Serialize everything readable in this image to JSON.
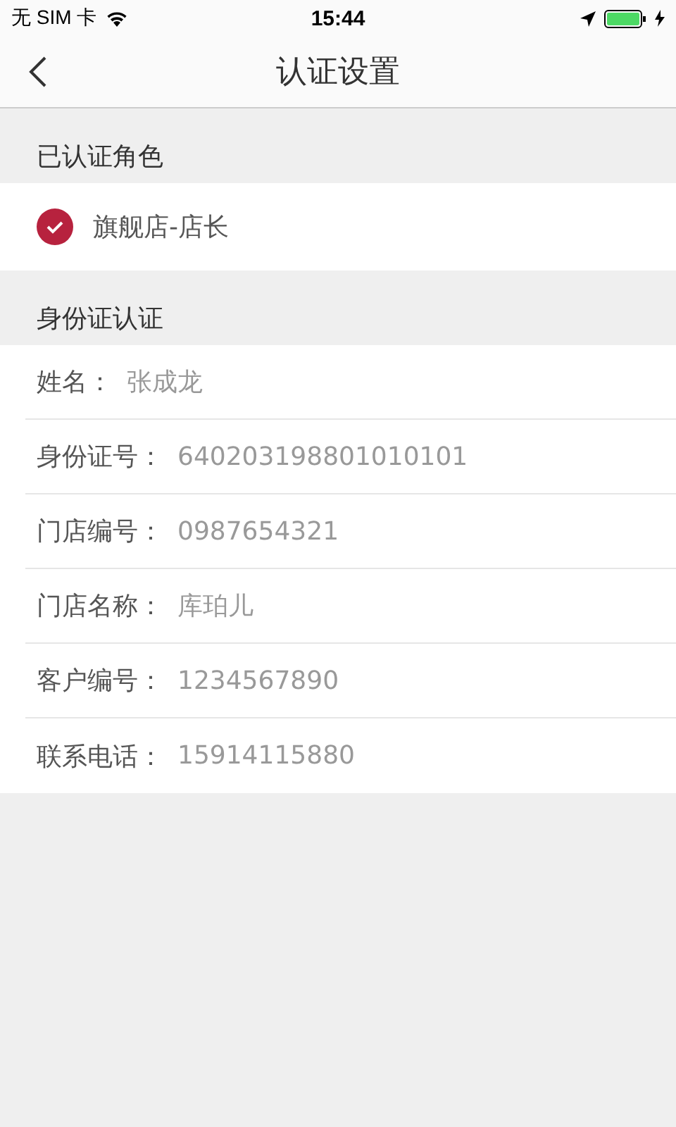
{
  "status_bar": {
    "carrier": "无 SIM 卡",
    "time": "15:44"
  },
  "nav": {
    "title": "认证设置"
  },
  "roles_section": {
    "title": "已认证角色",
    "roles": [
      {
        "name": "旗舰店-店长",
        "checked": true
      }
    ]
  },
  "id_section": {
    "title": "身份证认证",
    "fields": [
      {
        "label": "姓名：",
        "value": "张成龙"
      },
      {
        "label": "身份证号：",
        "value": "640203198801010101"
      },
      {
        "label": "门店编号：",
        "value": "0987654321"
      },
      {
        "label": "门店名称：",
        "value": "库珀儿"
      },
      {
        "label": "客户编号：",
        "value": "1234567890"
      },
      {
        "label": "联系电话：",
        "value": "15914115880"
      }
    ]
  }
}
